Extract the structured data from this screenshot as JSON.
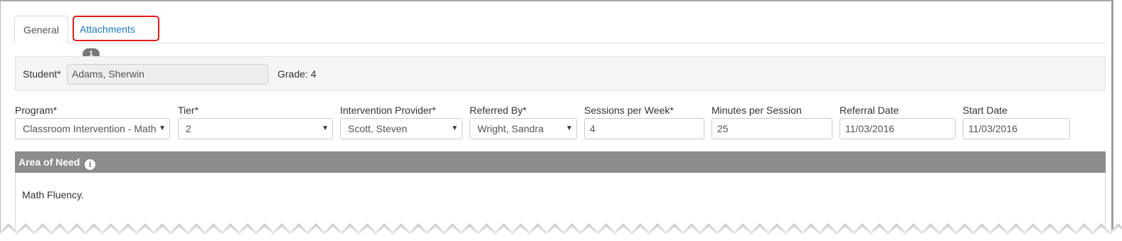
{
  "tabs": {
    "general": "General",
    "attachments": "Attachments",
    "attachments_count": "1"
  },
  "student": {
    "label": "Student*",
    "value": "Adams, Sherwin",
    "grade_text": "Grade: 4"
  },
  "fields": {
    "program": {
      "label": "Program*",
      "value": "Classroom Intervention - Math"
    },
    "tier": {
      "label": "Tier*",
      "value": "2"
    },
    "provider": {
      "label": "Intervention Provider*",
      "value": "Scott, Steven"
    },
    "referred_by": {
      "label": "Referred By*",
      "value": "Wright, Sandra"
    },
    "sessions": {
      "label": "Sessions per Week*",
      "value": "4"
    },
    "minutes": {
      "label": "Minutes per Session",
      "value": "25"
    },
    "referral_date": {
      "label": "Referral Date",
      "value": "11/03/2016"
    },
    "start_date": {
      "label": "Start Date",
      "value": "11/03/2016"
    }
  },
  "area_of_need": {
    "title": "Area of Need",
    "text": "Math Fluency."
  },
  "icons": {
    "info": "info-icon",
    "select_caret": "caret-down-icon"
  },
  "colors": {
    "link": "#1d7ac1",
    "highlight": "#e21d1d",
    "section_header": "#8c8c8c",
    "badge": "#777777"
  }
}
